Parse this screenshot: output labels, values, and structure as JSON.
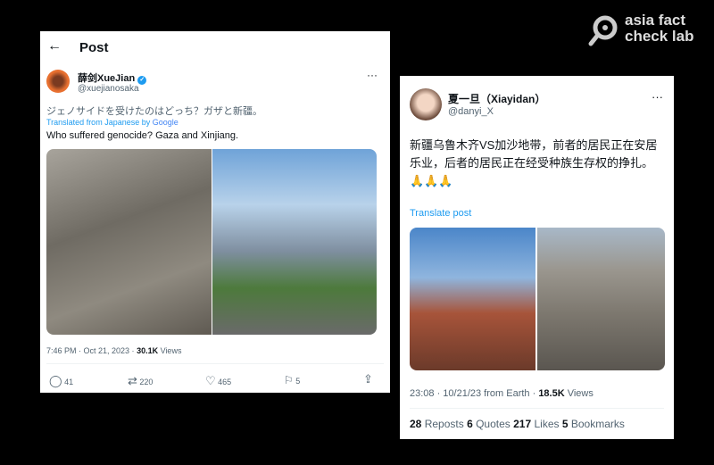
{
  "logo": {
    "line1": "asia fact",
    "line2": "check lab"
  },
  "post1": {
    "header": "Post",
    "display_name": "薛剑XueJian",
    "handle": "@xuejianosaka",
    "verified": true,
    "original_text": "ジェノサイドを受けたのはどっち？ガザと新疆。",
    "translated_from": "Translated from Japanese by",
    "translator": "Google",
    "translation": "Who suffered genocide? Gaza and Xinjiang.",
    "time": "7:46 PM · Oct 21, 2023 · ",
    "views_count": "30.1K",
    "views_label": " Views",
    "actions": {
      "replies": "41",
      "reposts": "220",
      "likes": "465",
      "bookmarks": "5"
    }
  },
  "post2": {
    "display_name": "夏一旦（Xiayidan）",
    "handle": "@danyi_X",
    "text": "新疆乌鲁木齐VS加沙地带，前者的居民正在安居乐业，后者的居民正在经受种族生存权的挣扎。🙏🙏🙏",
    "translate": "Translate post",
    "time": "23:08 · 10/21/23 from Earth · ",
    "views_count": "18.5K",
    "views_label": " Views",
    "stats": {
      "reposts": "28",
      "reposts_label": " Repost s",
      "quotes": "6",
      "quotes_label": " Quotes",
      "likes": "217",
      "likes_label": " Likes",
      "bookmarks": "5",
      "bookmarks_label": " Bookmarks"
    }
  },
  "colors": {
    "link": "#1d9bf0",
    "verified": "#1d9bf0",
    "muted": "#536471"
  }
}
